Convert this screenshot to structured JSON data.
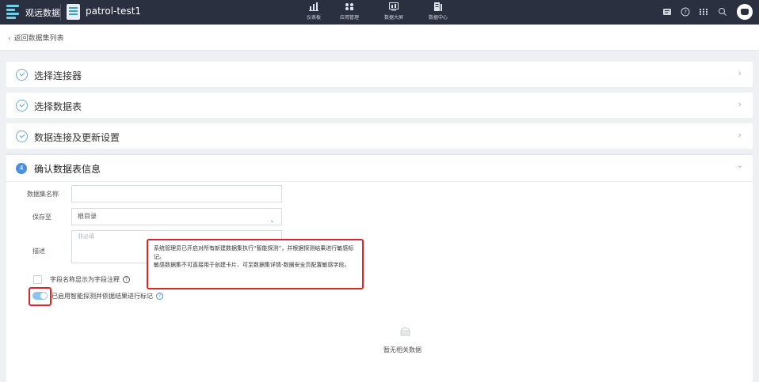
{
  "topbar": {
    "brand": "观远数据",
    "app_name": "patrol-test1",
    "nav": [
      {
        "label": "仪表板",
        "icon": "bar-chart-icon"
      },
      {
        "label": "应用管理",
        "icon": "apps-icon"
      },
      {
        "label": "数据大屏",
        "icon": "screen-icon"
      },
      {
        "label": "数据中心",
        "icon": "database-icon"
      }
    ],
    "right_icons": [
      "message-icon",
      "help-icon",
      "grid-icon",
      "search-icon",
      "avatar"
    ]
  },
  "subheader": {
    "back_label": "返回数据集列表"
  },
  "steps": [
    {
      "title": "选择连接器",
      "status": "done"
    },
    {
      "title": "选择数据表",
      "status": "done"
    },
    {
      "title": "数据连接及更新设置",
      "status": "done"
    }
  ],
  "panel": {
    "number": "4",
    "title": "确认数据表信息",
    "fields": {
      "name_label": "数据集名称",
      "name_value": "",
      "save_label": "保存至",
      "save_value": "根目录",
      "desc_label": "描述",
      "desc_placeholder": "非必填"
    },
    "checkbox_label": "字段名称显示为字段注释",
    "toggle_label": "已启用智能探测并依据结果进行标记",
    "tooltip": {
      "line1": "系统管理员已开启对所有新建数据集执行“智能探测”，并根据探测结果进行敏感标记。",
      "line2": "敏感数据集不可直接用于创建卡片、可至数据集详情-数据安全页配置敏感字段。"
    },
    "empty_text": "暂无相关数据"
  },
  "colors": {
    "topbar": "#2b3040",
    "accent": "#4a90e2",
    "highlight": "#e02424"
  }
}
